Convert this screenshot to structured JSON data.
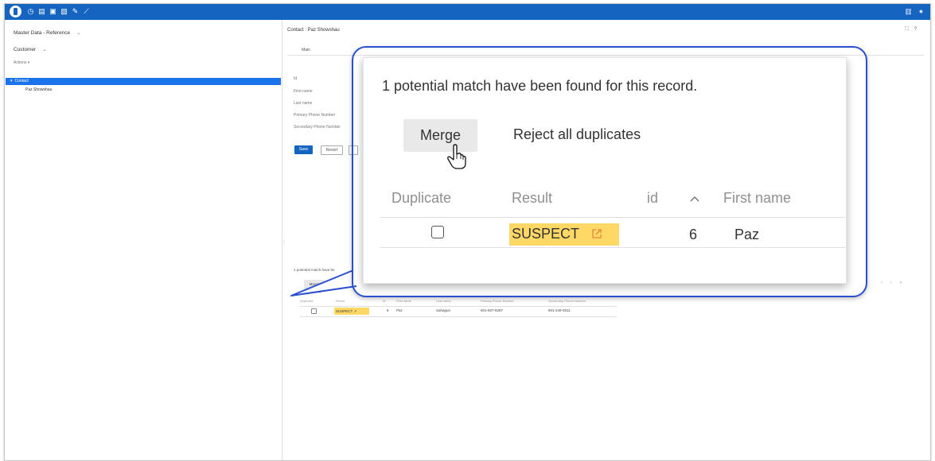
{
  "left_panel": {
    "title": "Master Data - Reference",
    "entity": "Customer",
    "actions": "Actions",
    "tree": {
      "node": "Contact",
      "child": "Paz Showshau"
    }
  },
  "record": {
    "title": "Contact : Paz Showshau",
    "tab": "Main",
    "fields": [
      "Id",
      "First name",
      "Last name",
      "Primary Phone Number",
      "Secondary Phone Number"
    ],
    "save_label": "Save",
    "revert_label": "Revert"
  },
  "small_panel": {
    "message": "1 potential match have be",
    "merge": "Merge",
    "reject": "Reje",
    "headers": [
      "Duplicate",
      "Result",
      "id",
      "First name",
      "Last name",
      "Primary Phone Number",
      "Secondary Phone Number"
    ],
    "row": {
      "result": "SUSPECT",
      "id": "6",
      "first_name": "Paz",
      "last_name": "Sahagun",
      "primary_phone": "601-927-8287",
      "secondary_phone": "601-249-4511"
    }
  },
  "dialog": {
    "message": "1 potential match have been found for this record.",
    "merge_label": "Merge",
    "reject_label": "Reject all duplicates",
    "headers": {
      "duplicate": "Duplicate",
      "result": "Result",
      "id": "id",
      "first_name": "First name"
    },
    "row": {
      "checked": false,
      "result": "SUSPECT",
      "id": "6",
      "first_name": "Paz"
    }
  },
  "colors": {
    "brand": "#1565c0",
    "selection": "#1a73e8",
    "highlight": "#ffd866",
    "callout": "#2b4fcf"
  },
  "icons": [
    "app-logo-icon",
    "clock-icon",
    "document-icon",
    "folder-icon",
    "doc-edit-icon",
    "pin-icon",
    "wrench-icon",
    "grid-icon",
    "user-icon",
    "expand-icon",
    "help-icon",
    "hand-cursor-icon",
    "sort-ascending-icon",
    "external-link-icon"
  ]
}
